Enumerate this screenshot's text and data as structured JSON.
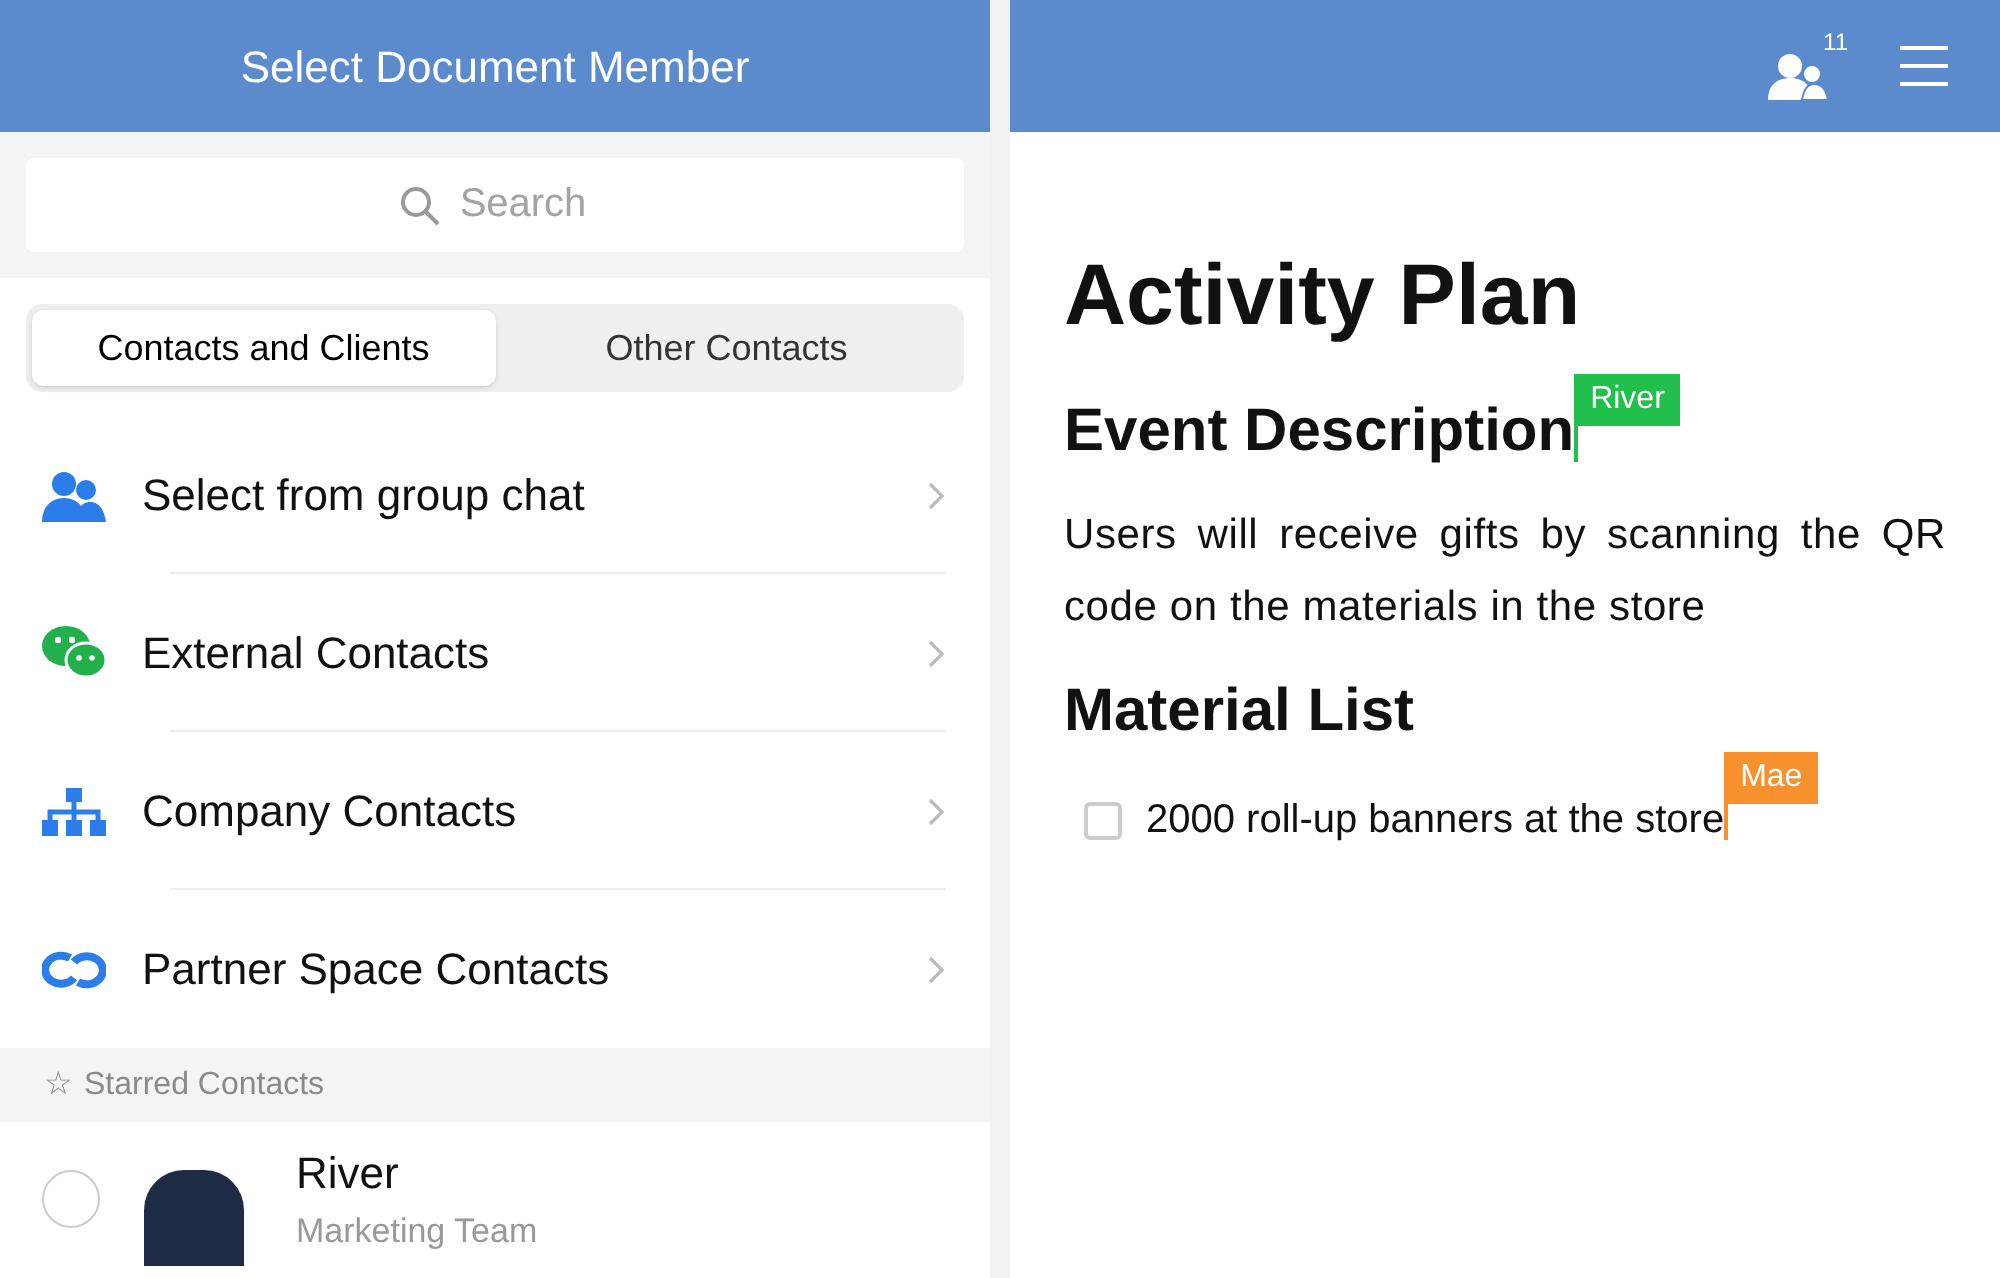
{
  "left_panel": {
    "title": "Select Document Member",
    "search": {
      "placeholder": "Search"
    },
    "tabs": [
      {
        "label": "Contacts and Clients",
        "selected": true
      },
      {
        "label": "Other Contacts",
        "selected": false
      }
    ],
    "menu_items": [
      {
        "kind": "group",
        "label": "Select from group chat"
      },
      {
        "kind": "chat",
        "label": "External Contacts"
      },
      {
        "kind": "org",
        "label": "Company Contacts"
      },
      {
        "kind": "link",
        "label": "Partner Space Contacts"
      }
    ],
    "section_header": {
      "icon": "☆",
      "label": "Starred Contacts"
    },
    "contacts": [
      {
        "name": "River",
        "team": "Marketing Team",
        "selected": false
      }
    ]
  },
  "right_panel": {
    "header": {
      "member_count": "11"
    },
    "document": {
      "title": "Activity Plan",
      "blocks": [
        {
          "kind": "heading",
          "text": "Event Description",
          "cursor": {
            "name": "River",
            "color": "#21bf4b"
          }
        },
        {
          "kind": "paragraph",
          "text": "Users will receive gifts by scanning the QR code on the materials in the store"
        },
        {
          "kind": "heading",
          "text": "Material List"
        },
        {
          "kind": "todo",
          "text": "2000 roll-up banners at the store",
          "checked": false,
          "cursor": {
            "name": "Mae",
            "color": "#f7912e"
          }
        }
      ]
    }
  }
}
